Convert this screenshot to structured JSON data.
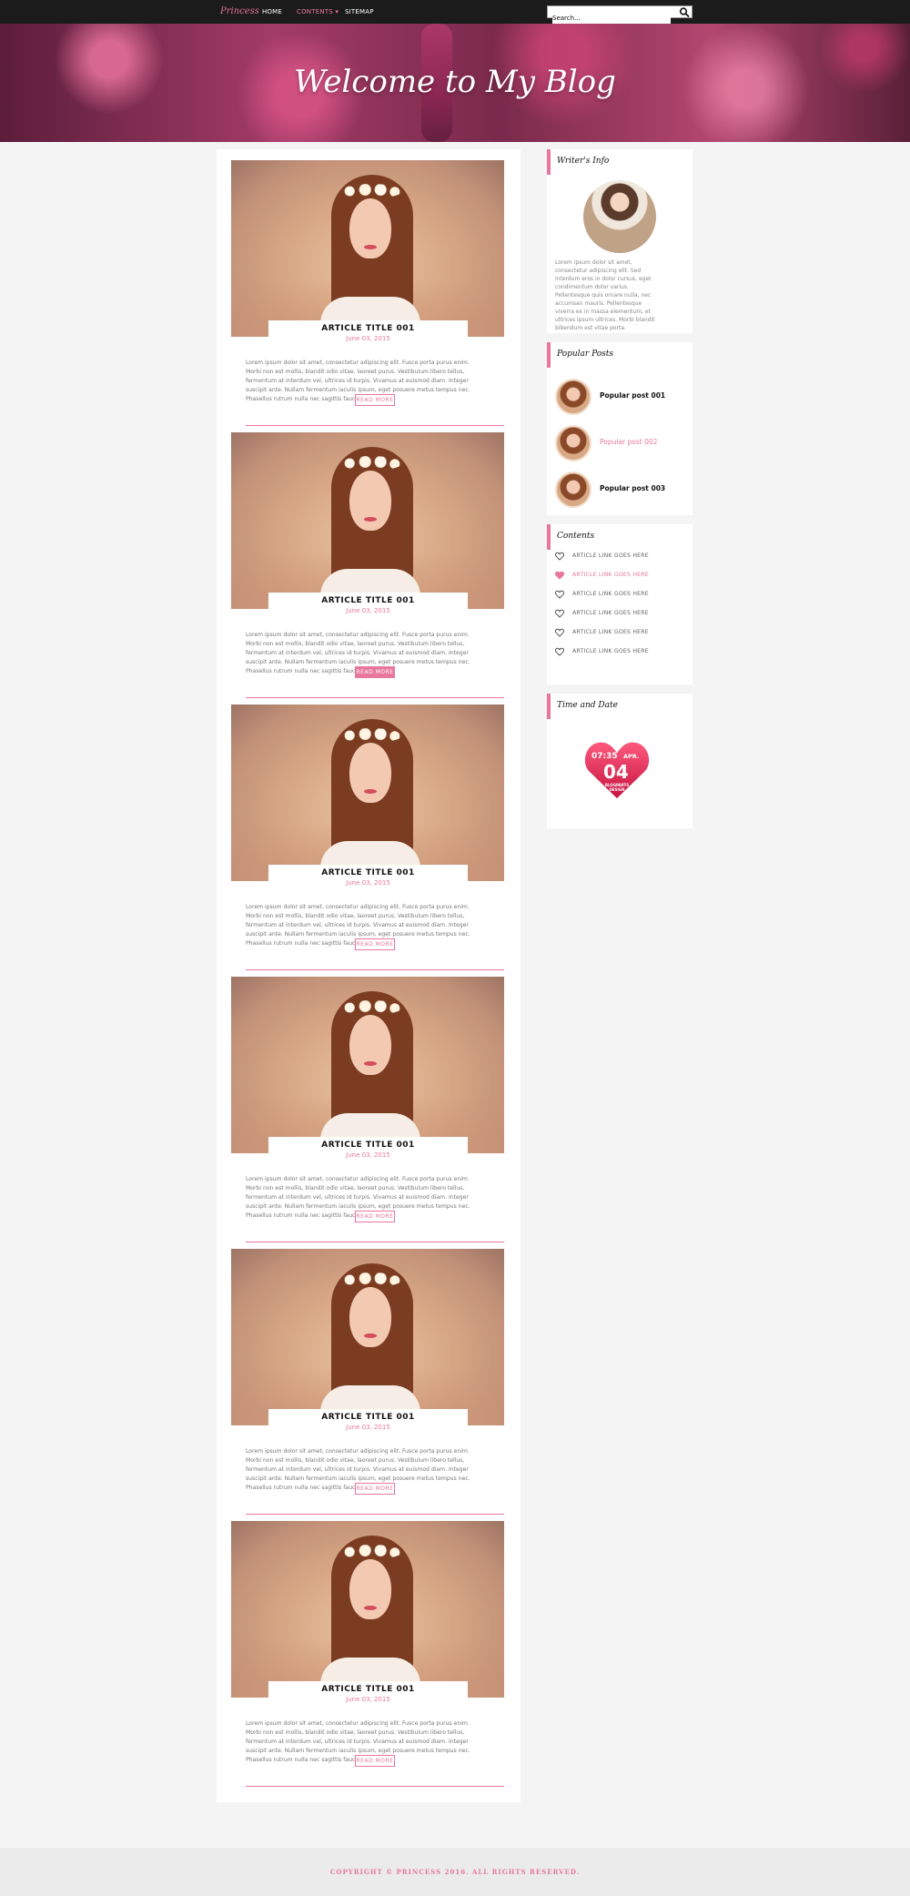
{
  "nav": {
    "brand": "Princess",
    "links": [
      "HOME",
      "CONTENTS ▾",
      "SITEMAP"
    ],
    "search_placeholder": "Search..."
  },
  "hero": {
    "title": "Welcome to My Blog"
  },
  "posts": [
    {
      "title": "ARTICLE TITLE 001",
      "date": "June 03, 2015",
      "read_more": "READ MORE"
    },
    {
      "title": "ARTICLE TITLE 001",
      "date": "June 03, 2015",
      "read_more": "READ MORE"
    },
    {
      "title": "ARTICLE TITLE 001",
      "date": "June 03, 2015",
      "read_more": "READ MORE"
    },
    {
      "title": "ARTICLE TITLE 001",
      "date": "June 03, 2015",
      "read_more": "READ MORE"
    },
    {
      "title": "ARTICLE TITLE 001",
      "date": "June 03, 2015",
      "read_more": "READ MORE"
    },
    {
      "title": "ARTICLE TITLE 001",
      "date": "June 03, 2015",
      "read_more": "READ MORE"
    }
  ],
  "post_excerpt": "Lorem ipsum dolor sit amet, consectetur adipiscing elit. Fusce porta purus enim. Morbi non est mollis, blandit odio vitae, laoreet purus. Vestibulum libero tellus, fermentum at interdum vel, ultrices id turpis. Vivamus at euismod diam. Integer suscipit ante. Nullam fermentum iaculis ipsum, eget posuere metus tempus nec. Phasellus rutrum nulla nec sagittis faucibus.",
  "sidebar": {
    "writer": {
      "title": "Writer's Info",
      "text": "Lorem ipsum dolor sit amet, consectetur adipiscing elit. Sed interdum eros in dolor cursus, eget condimentum dolor varius. Pellentesque quis ornare nulla, nec accumsan mauris. Pellentesque viverra ex in massa elementum, et ultrices ipsum ultrices. Morbi blandit bibendum est vitae porta."
    },
    "popular": {
      "title": "Popular Posts",
      "items": [
        "Popular post 001",
        "Popular post 002",
        "Popular post 003"
      ]
    },
    "contents": {
      "title": "Contents",
      "items": [
        "ARTICLE LINK GOES HERE",
        "ARTICLE LINK GOES HERE",
        "ARTICLE LINK GOES HERE",
        "ARTICLE LINK GOES HERE",
        "ARTICLE LINK GOES HERE",
        "ARTICLE LINK GOES HERE"
      ]
    },
    "time": {
      "title": "Time and Date",
      "time": "07:35",
      "month": "APR.",
      "day": "04",
      "credit": "BLOGPARTS DESIGN"
    }
  },
  "footer": {
    "text": "COPYRIGHT © PRINCESS 2016. ALL RIGHTS RESERVED."
  },
  "colors": {
    "accent": "#e8779d",
    "nav_bg": "#1b1b1b",
    "page_bg": "#f4f4f4"
  }
}
